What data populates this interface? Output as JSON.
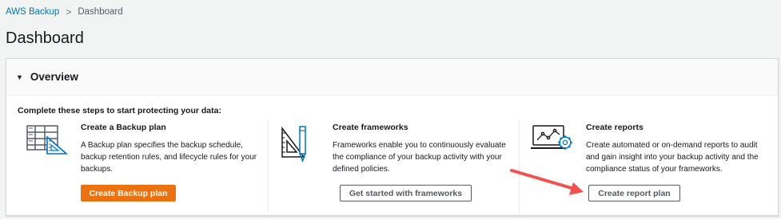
{
  "breadcrumb": {
    "root": "AWS Backup",
    "separator": ">",
    "current": "Dashboard"
  },
  "page": {
    "title": "Dashboard"
  },
  "overview": {
    "title": "Overview",
    "intro": "Complete these steps to start protecting your data:",
    "steps": [
      {
        "icon": "backup-plan-blueprint-icon",
        "title": "Create a Backup plan",
        "description": "A Backup plan specifies the backup schedule, backup retention rules, and lifecycle rules for your backups.",
        "button": "Create Backup plan"
      },
      {
        "icon": "frameworks-ruler-pencil-icon",
        "title": "Create frameworks",
        "description": "Frameworks enable you to continuously evaluate the compliance of your backup activity with your defined policies.",
        "button": "Get started with frameworks"
      },
      {
        "icon": "reports-chart-gear-icon",
        "title": "Create reports",
        "description": "Create automated or on-demand reports to audit and gain insight into your backup activity and the compliance status of your frameworks.",
        "button": "Create report plan"
      }
    ]
  },
  "colors": {
    "link": "#0073bb",
    "primary_button": "#ec7211",
    "annotation_arrow": "#f0524f"
  }
}
